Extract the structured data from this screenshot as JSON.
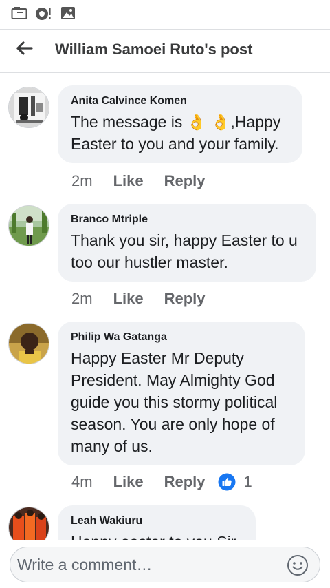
{
  "status_bar": {
    "icons": [
      "news-feed-icon",
      "messenger-alert-icon",
      "gallery-icon"
    ]
  },
  "header": {
    "title": "William Samoei Ruto's post"
  },
  "comments": [
    {
      "author": "Anita Calvince Komen",
      "text_before": "The message is ",
      "emoji": "👌 👌",
      "text_after": ",Happy\nEaster to you and your family.",
      "time": "2m",
      "like_label": "Like",
      "reply_label": "Reply"
    },
    {
      "author": "Branco Mtriple",
      "text": "Thank you sir, happy Easter to u\ntoo our hustler master.",
      "time": "2m",
      "like_label": "Like",
      "reply_label": "Reply"
    },
    {
      "author": "Philip Wa Gatanga",
      "text": "Happy Easter Mr Deputy\nPresident. May Almighty God\nguide you this stormy political\nseason. You are only hope of\nmany of us.",
      "time": "4m",
      "like_label": "Like",
      "reply_label": "Reply",
      "reaction_icon": "like-thumb-icon",
      "reaction_count": "1"
    },
    {
      "author": "Leah Wakiuru",
      "text": "Happy easter to you Sir"
    }
  ],
  "composer": {
    "placeholder": "Write a comment…",
    "emoji_icon": "smiley-icon"
  },
  "colors": {
    "bubble": "#f0f2f5",
    "meta_text": "#65676b",
    "like_blue": "#1877f2"
  }
}
